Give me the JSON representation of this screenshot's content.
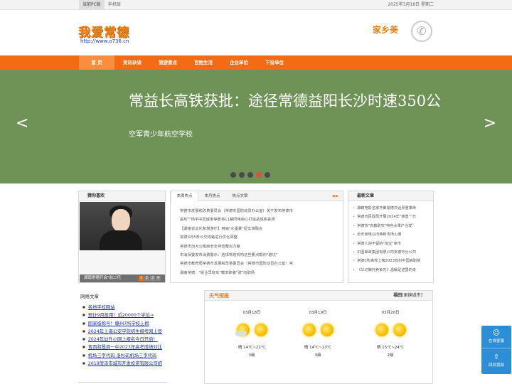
{
  "topbar": {
    "items": [
      "当前PC版",
      "手机版"
    ],
    "date": "2025年3月18日 星期二"
  },
  "header": {
    "logo": "我爱常德",
    "url": "http://www.o736.cn",
    "brand": "家乡美"
  },
  "nav": {
    "items": [
      "首 页",
      "资讯杂谈",
      "旅游景点",
      "百姓生活",
      "企业单位",
      "下设单位"
    ]
  },
  "banner": {
    "title": "常益长高铁获批：途径常德益阳长沙时速350公",
    "subtitle": "空军青少年航空学校",
    "prev": "<",
    "next": ">",
    "dot_count": 5,
    "active_dot": 3
  },
  "photo_box": {
    "title": "猜你喜欢",
    "caption": "湖南常德开会\"前二代",
    "pages": [
      "1",
      "2",
      "3",
      "4"
    ]
  },
  "news_tabs": {
    "tabs": [
      "本周热点",
      "本月热点",
      "热点文章"
    ],
    "arrows": "◀ ▶",
    "items": [
      "常德市发展和改革委员会（常德市国防动员办公室）关于发布常德市",
      "岳坨\"\"场平中区域率停靠将11路同电用心打造岳悦收喜场",
      "【湖南省文化和旅游厅】用画\"水墨暑\"促文旅融合",
      "常德3月5条公交线路进行优化调整",
      "常德市加大公租房安全排查整治力度",
      "市消保委发布消费警示：选择驾培机构这些要点帮你\"避坑\"",
      "常德市教育局常德市发展和改革委员会（常德市国防动员办公室）常",
      "湖南常德：\"就业早班车\"载求职者\"驶\"向职场"
    ]
  },
  "latest": {
    "title": "最新文章",
    "items": [
      "湘籍电影名家齐聚常德共话厚重革命",
      "常德市民政局开展2024年\"慈善一日",
      "常德市\"农教助农\"特色水果产业发",
      "全市家电以旧换新市场火爆",
      "常德人迎不留的\"淘宝\"宰市",
      "中国邮政集团有限公司常德市分公司",
      "常德2所高校上榜2023软科中国高职院",
      "《华记懒托养争先》温暖足迹里的辛"
    ]
  },
  "network": {
    "title": "网络文章",
    "items": [
      "各地学校网站",
      "预计9月投用！近20000个学位→",
      "国家级称号！赣州7所学校上榜",
      "2024年上海公安学院招生报考网上登",
      "2024年幼升小网上报名今日开启！",
      "青西和殷商一中2023年高考成绩对比",
      "机场三字代码 洛杉矶机场三字代码",
      "2019菏泽市城市开发投资有限公司招"
    ]
  },
  "weather": {
    "title": "天气预报",
    "city": "福田",
    "switch": "[更换城市]",
    "days": [
      {
        "date": "03月18日",
        "condition": "晴",
        "temp": "14℃~22℃",
        "wind": "3级"
      },
      {
        "date": "03月19日",
        "condition": "晴",
        "temp": "14℃~23℃",
        "wind": "3级"
      },
      {
        "date": "03月20日",
        "condition": "晴",
        "temp": "15℃~24℃",
        "wind": "2级"
      }
    ]
  },
  "float_tools": {
    "consult": "在线客服",
    "top": "回到顶部"
  }
}
